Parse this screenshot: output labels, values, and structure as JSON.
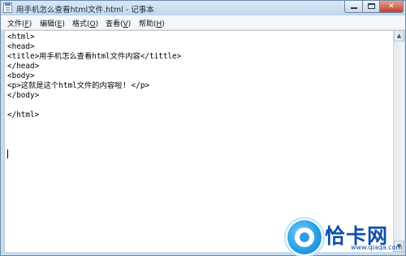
{
  "window": {
    "title": "用手机怎么查看html文件.html - 记事本",
    "buttons": {
      "minimize": "minimize",
      "maximize": "maximize",
      "close": "✕"
    }
  },
  "menubar": {
    "items": [
      {
        "label": "文件(",
        "mnemonic": "F",
        "suffix": ")"
      },
      {
        "label": "编辑(",
        "mnemonic": "E",
        "suffix": ")"
      },
      {
        "label": "格式(",
        "mnemonic": "O",
        "suffix": ")"
      },
      {
        "label": "查看(",
        "mnemonic": "V",
        "suffix": ")"
      },
      {
        "label": "帮助(",
        "mnemonic": "H",
        "suffix": ")"
      }
    ]
  },
  "editor": {
    "lines": [
      "<html>",
      "<head>",
      "<title>用手机怎么查看html文件内容</tittle>",
      "</head>",
      "<body>",
      "<p>这就是这个html文件的内容啦! </p>",
      "</body>",
      "",
      "</html>"
    ]
  },
  "scrollbar": {
    "up": "▲",
    "down": "▼"
  },
  "watermark": {
    "brand": "恰卡网",
    "url": "www.qiaqa.com"
  },
  "icons": {
    "app": "notepad-icon",
    "minimize": "minimize-icon",
    "maximize": "maximize-icon",
    "close": "close-icon",
    "watermark": "qiaqa-logo"
  },
  "colors": {
    "titlebar": "#c9dcee",
    "close_button": "#c1412a",
    "watermark_text": "#0d4fa8"
  }
}
